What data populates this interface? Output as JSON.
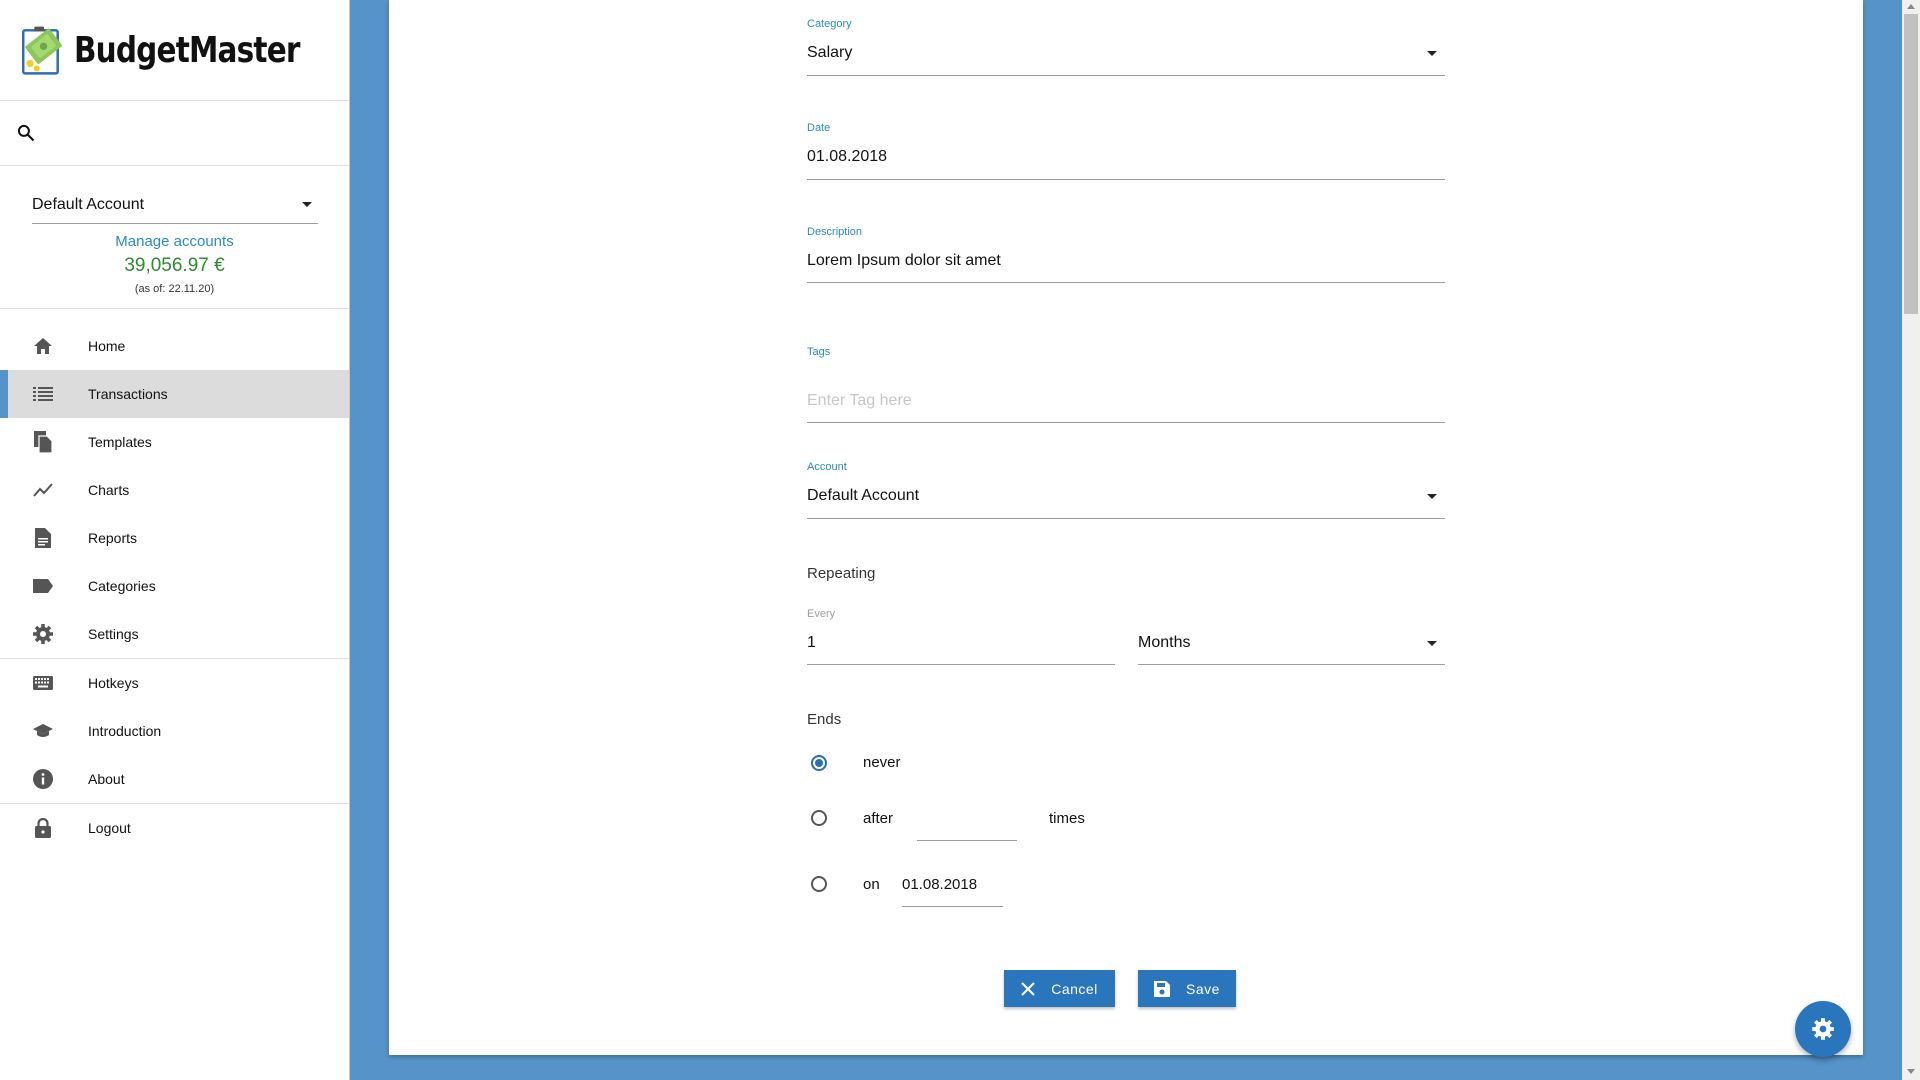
{
  "app": {
    "name": "BudgetMaster"
  },
  "sidebar": {
    "account": {
      "selected": "Default Account",
      "manage_link": "Manage accounts",
      "balance": "39,056.97 €",
      "as_of": "(as of: 22.11.20)"
    },
    "items": [
      {
        "label": "Home",
        "icon": "home-icon"
      },
      {
        "label": "Transactions",
        "icon": "list-icon",
        "active": true
      },
      {
        "label": "Templates",
        "icon": "file-copy-icon"
      },
      {
        "label": "Charts",
        "icon": "chart-line-icon"
      },
      {
        "label": "Reports",
        "icon": "document-icon"
      },
      {
        "label": "Categories",
        "icon": "label-icon"
      },
      {
        "label": "Settings",
        "icon": "gear-icon"
      },
      {
        "label": "Hotkeys",
        "icon": "keyboard-icon"
      },
      {
        "label": "Introduction",
        "icon": "graduation-cap-icon"
      },
      {
        "label": "About",
        "icon": "info-icon"
      },
      {
        "label": "Logout",
        "icon": "lock-icon"
      }
    ]
  },
  "form": {
    "category": {
      "label": "Category",
      "value": "Salary"
    },
    "date": {
      "label": "Date",
      "value": "01.08.2018"
    },
    "description": {
      "label": "Description",
      "value": "Lorem Ipsum dolor sit amet"
    },
    "tags": {
      "label": "Tags",
      "placeholder": "Enter Tag here"
    },
    "account": {
      "label": "Account",
      "value": "Default Account"
    },
    "repeating": {
      "title": "Repeating",
      "every_label": "Every",
      "every_value": "1",
      "unit": "Months"
    },
    "ends": {
      "title": "Ends",
      "never": "never",
      "after": "after",
      "times": "times",
      "on": "on",
      "on_date": "01.08.2018",
      "selected": "never"
    },
    "buttons": {
      "cancel": "Cancel",
      "save": "Save"
    }
  },
  "colors": {
    "accent": "#2a76bd",
    "background": "#5593c8",
    "balance": "#2e8b2e",
    "link": "#2a8ac4"
  }
}
